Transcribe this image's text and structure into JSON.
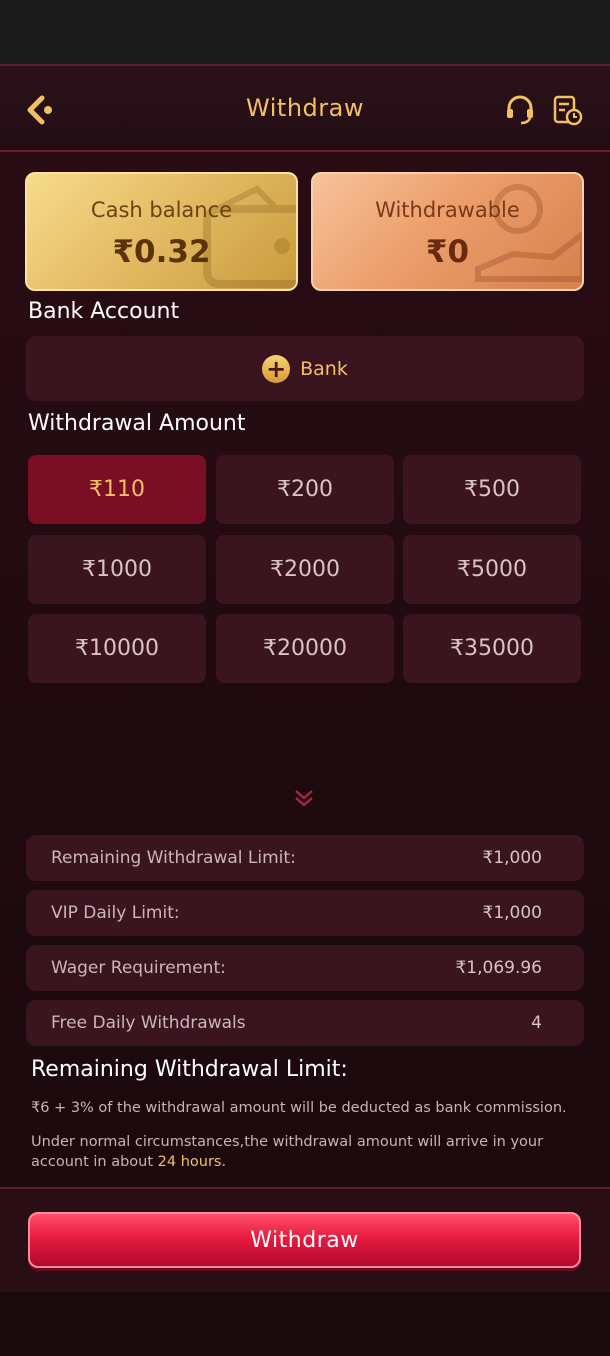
{
  "header": {
    "title": "Withdraw",
    "back_icon": "back-arrow-icon",
    "support_icon": "headset-icon",
    "records_icon": "records-clock-icon"
  },
  "balances": {
    "cash_label": "Cash balance",
    "cash_amount": "₹0.32",
    "withdrawable_label": "Withdrawable",
    "withdrawable_amount": "₹0"
  },
  "bank": {
    "section_title": "Bank Account",
    "add_label": "Bank"
  },
  "amounts": {
    "section_title": "Withdrawal Amount",
    "options": [
      "₹110",
      "₹200",
      "₹500",
      "₹1000",
      "₹2000",
      "₹5000",
      "₹10000",
      "₹20000",
      "₹35000"
    ],
    "selected_index": 0
  },
  "limits": [
    {
      "label": "Remaining Withdrawal Limit:",
      "value": "₹1,000"
    },
    {
      "label": "VIP Daily Limit:",
      "value": "₹1,000"
    },
    {
      "label": "Wager Requirement:",
      "value": "₹1,069.96"
    },
    {
      "label": "Free Daily Withdrawals",
      "value": "4"
    }
  ],
  "rules": {
    "title": "Remaining Withdrawal Limit:",
    "note1": "₹6 + 3% of the withdrawal amount will be deducted as bank commission.",
    "note2_line1": "Under normal circumstances,the withdrawal amount will arrive in your",
    "note2_prefix": "account in about ",
    "note2_highlight": "24 hours",
    "note2_suffix": "."
  },
  "footer": {
    "withdraw_label": "Withdraw"
  },
  "colors": {
    "accent_gold": "#f2c063",
    "selected_amount": "#7a0e24",
    "primary_button": "#e81b41"
  }
}
